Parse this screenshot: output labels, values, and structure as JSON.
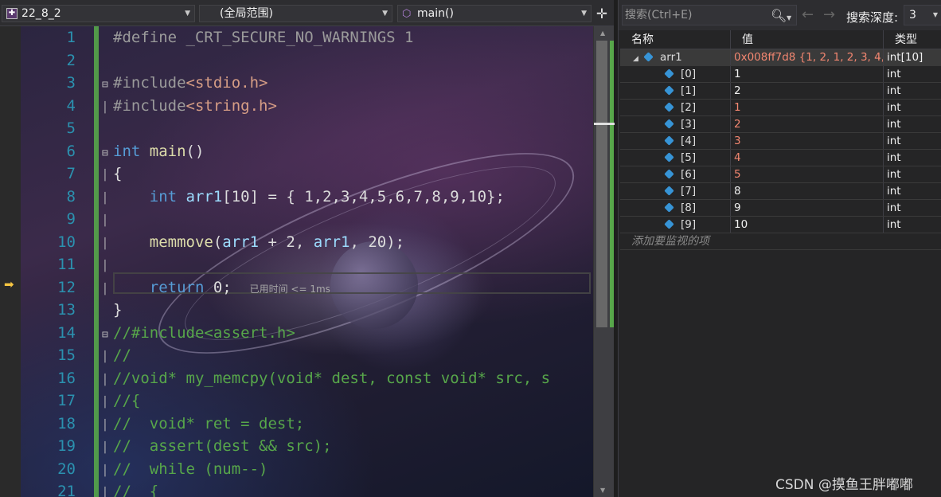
{
  "toolbar": {
    "project": "22_8_2",
    "scope": "(全局范围)",
    "function": "main()"
  },
  "editor": {
    "line_numbers": [
      "1",
      "2",
      "3",
      "4",
      "5",
      "6",
      "7",
      "8",
      "9",
      "10",
      "11",
      "12",
      "13",
      "14",
      "15",
      "16",
      "17",
      "18",
      "19",
      "20",
      "21"
    ],
    "perf_tip": "已用时间 <= 1ms",
    "lines": {
      "l1": "#define _CRT_SECURE_NO_WARNINGS 1",
      "l3a": "#include",
      "l3b": "<stdio.h>",
      "l4a": "#include",
      "l4b": "<string.h>",
      "l6a": "int",
      "l6b": "main",
      "l6c": "()",
      "l7": "{",
      "l8a": "    int",
      "l8b": " arr1",
      "l8c": "[10] = { 1,2,3,4,5,6,7,8,9,10};",
      "l10a": "    memmove",
      "l10b": "(",
      "l10c": "arr1",
      "l10d": " + 2, ",
      "l10e": "arr1",
      "l10f": ", 20);",
      "l12a": "    return",
      "l12b": " 0;",
      "l13": "}",
      "l14": "//#include<assert.h>",
      "l15": "//",
      "l16": "//void* my_memcpy(void* dest, const void* src, s",
      "l17": "//{",
      "l18": "//  void* ret = dest;",
      "l19": "//  assert(dest && src);",
      "l20": "//  while (num--)",
      "l21": "//  {"
    }
  },
  "watch": {
    "search_placeholder": "搜索(Ctrl+E)",
    "depth_label": "搜索深度:",
    "depth_value": "3",
    "headers": {
      "name": "名称",
      "value": "值",
      "type": "类型"
    },
    "root": {
      "name": "arr1",
      "value": "0x008ff7d8 {1, 2, 1, 2, 3, 4, ...",
      "type": "int[10]"
    },
    "items": [
      {
        "name": "[0]",
        "value": "1",
        "type": "int",
        "changed": false
      },
      {
        "name": "[1]",
        "value": "2",
        "type": "int",
        "changed": false
      },
      {
        "name": "[2]",
        "value": "1",
        "type": "int",
        "changed": true
      },
      {
        "name": "[3]",
        "value": "2",
        "type": "int",
        "changed": true
      },
      {
        "name": "[4]",
        "value": "3",
        "type": "int",
        "changed": true
      },
      {
        "name": "[5]",
        "value": "4",
        "type": "int",
        "changed": true
      },
      {
        "name": "[6]",
        "value": "5",
        "type": "int",
        "changed": true
      },
      {
        "name": "[7]",
        "value": "8",
        "type": "int",
        "changed": false
      },
      {
        "name": "[8]",
        "value": "9",
        "type": "int",
        "changed": false
      },
      {
        "name": "[9]",
        "value": "10",
        "type": "int",
        "changed": false
      }
    ],
    "add_watch": "添加要监视的项"
  },
  "watermark": "CSDN @摸鱼王胖嘟嘟",
  "colors": {
    "changed_value": "#f48771",
    "keyword": "#569cd6",
    "comment": "#57a64a",
    "line_number": "#2b91af",
    "exec_arrow": "#f5c542"
  }
}
